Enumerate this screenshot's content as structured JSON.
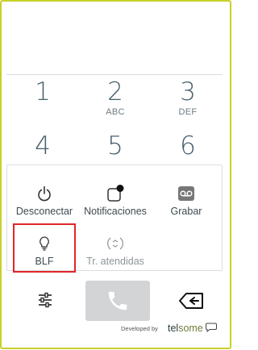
{
  "dialpad": {
    "keys": [
      {
        "digit": "1",
        "letters": ""
      },
      {
        "digit": "2",
        "letters": "ABC"
      },
      {
        "digit": "3",
        "letters": "DEF"
      },
      {
        "digit": "4",
        "letters": ""
      },
      {
        "digit": "5",
        "letters": ""
      },
      {
        "digit": "6",
        "letters": ""
      }
    ]
  },
  "actions": {
    "disconnect": {
      "label": "Desconectar",
      "icon": "power-icon"
    },
    "notifications": {
      "label": "Notificaciones",
      "icon": "notification-icon"
    },
    "record": {
      "label": "Grabar",
      "icon": "voicemail-icon"
    },
    "blf": {
      "label": "BLF",
      "icon": "lightbulb-icon"
    },
    "call_transfer": {
      "label": "Tr. atendidas",
      "icon": "transfer-icon"
    }
  },
  "bottom_bar": {
    "settings_icon": "sliders-icon",
    "call_icon": "phone-icon",
    "backspace_icon": "backspace-icon"
  },
  "footer": {
    "developed_by": "Developed by",
    "brand_part1": "tel",
    "brand_part2": "some"
  },
  "colors": {
    "frame_border": "#c8cf2a",
    "digit_text": "#46606a",
    "highlight_border": "#e0262a",
    "call_button_bg": "#d2d4d5"
  }
}
